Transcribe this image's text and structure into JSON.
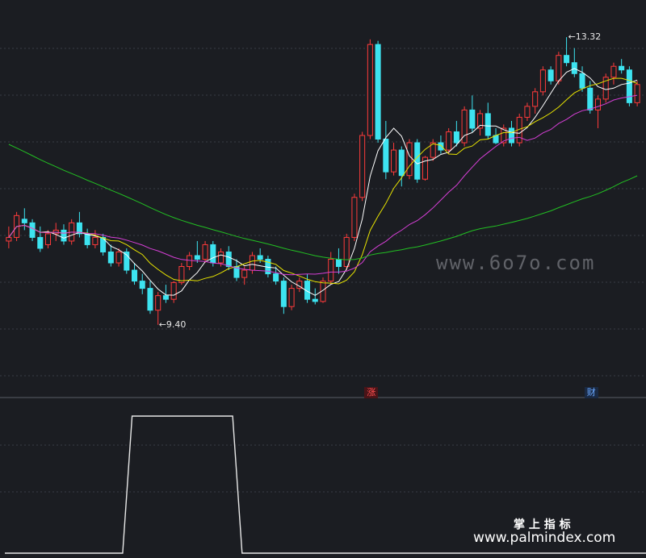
{
  "chart_data": [
    {
      "type": "candlestick",
      "panel": "main",
      "ylim": [
        8.6,
        13.75
      ],
      "candles": [
        [
          10.55,
          10.75,
          10.45,
          10.6
        ],
        [
          10.6,
          10.95,
          10.55,
          10.9
        ],
        [
          10.85,
          11.0,
          10.7,
          10.8
        ],
        [
          10.8,
          10.85,
          10.55,
          10.6
        ],
        [
          10.6,
          10.75,
          10.4,
          10.45
        ],
        [
          10.5,
          10.7,
          10.45,
          10.65
        ],
        [
          10.65,
          10.8,
          10.55,
          10.7
        ],
        [
          10.7,
          10.78,
          10.5,
          10.55
        ],
        [
          10.55,
          10.85,
          10.5,
          10.8
        ],
        [
          10.8,
          10.95,
          10.6,
          10.65
        ],
        [
          10.65,
          10.72,
          10.45,
          10.5
        ],
        [
          10.5,
          10.7,
          10.45,
          10.6
        ],
        [
          10.6,
          10.65,
          10.35,
          10.4
        ],
        [
          10.4,
          10.5,
          10.2,
          10.25
        ],
        [
          10.25,
          10.45,
          10.2,
          10.4
        ],
        [
          10.4,
          10.45,
          10.1,
          10.15
        ],
        [
          10.15,
          10.25,
          9.95,
          10.0
        ],
        [
          10.0,
          10.1,
          9.82,
          9.9
        ],
        [
          9.9,
          10.0,
          9.55,
          9.6
        ],
        [
          9.6,
          9.85,
          9.4,
          9.8
        ],
        [
          9.8,
          9.95,
          9.7,
          9.75
        ],
        [
          9.75,
          10.0,
          9.7,
          9.98
        ],
        [
          9.98,
          10.25,
          9.95,
          10.2
        ],
        [
          10.2,
          10.4,
          10.15,
          10.35
        ],
        [
          10.35,
          10.55,
          10.25,
          10.3
        ],
        [
          10.3,
          10.55,
          10.25,
          10.5
        ],
        [
          10.5,
          10.55,
          10.2,
          10.25
        ],
        [
          10.25,
          10.45,
          10.2,
          10.4
        ],
        [
          10.4,
          10.48,
          10.15,
          10.2
        ],
        [
          10.2,
          10.3,
          10.0,
          10.05
        ],
        [
          10.05,
          10.2,
          9.95,
          10.15
        ],
        [
          10.15,
          10.4,
          10.1,
          10.35
        ],
        [
          10.35,
          10.45,
          10.25,
          10.3
        ],
        [
          10.3,
          10.35,
          10.05,
          10.1
        ],
        [
          10.1,
          10.2,
          9.95,
          10.0
        ],
        [
          10.0,
          10.05,
          9.55,
          9.65
        ],
        [
          9.65,
          9.95,
          9.6,
          9.9
        ],
        [
          9.9,
          10.05,
          9.85,
          10.0
        ],
        [
          10.0,
          10.1,
          9.7,
          9.75
        ],
        [
          9.75,
          9.9,
          9.68,
          9.72
        ],
        [
          9.72,
          10.05,
          9.7,
          10.0
        ],
        [
          10.0,
          10.4,
          9.95,
          10.3
        ],
        [
          10.3,
          10.45,
          10.1,
          10.2
        ],
        [
          10.2,
          10.65,
          10.15,
          10.6
        ],
        [
          10.6,
          11.2,
          10.55,
          11.15
        ],
        [
          11.15,
          12.05,
          11.1,
          12.0
        ],
        [
          12.0,
          13.32,
          11.95,
          13.25
        ],
        [
          13.25,
          13.3,
          11.9,
          11.95
        ],
        [
          11.95,
          12.2,
          11.4,
          11.5
        ],
        [
          11.5,
          11.9,
          11.45,
          11.8
        ],
        [
          11.8,
          11.85,
          11.3,
          11.45
        ],
        [
          11.45,
          11.95,
          11.4,
          11.9
        ],
        [
          11.9,
          11.95,
          11.35,
          11.4
        ],
        [
          11.4,
          11.72,
          11.38,
          11.7
        ],
        [
          11.7,
          11.95,
          11.65,
          11.9
        ],
        [
          11.9,
          12.0,
          11.75,
          11.8
        ],
        [
          11.8,
          12.1,
          11.75,
          12.05
        ],
        [
          12.05,
          12.2,
          11.85,
          11.9
        ],
        [
          11.9,
          12.4,
          11.85,
          12.35
        ],
        [
          12.35,
          12.55,
          12.05,
          12.1
        ],
        [
          12.1,
          12.35,
          12.0,
          12.3
        ],
        [
          12.3,
          12.45,
          11.95,
          12.0
        ],
        [
          12.0,
          12.1,
          11.88,
          11.9
        ],
        [
          11.9,
          12.15,
          11.85,
          12.1
        ],
        [
          12.1,
          12.2,
          11.85,
          11.9
        ],
        [
          11.9,
          12.3,
          11.85,
          12.25
        ],
        [
          12.25,
          12.45,
          12.2,
          12.4
        ],
        [
          12.4,
          12.65,
          12.3,
          12.6
        ],
        [
          12.6,
          12.95,
          12.55,
          12.9
        ],
        [
          12.9,
          12.95,
          12.7,
          12.75
        ],
        [
          12.75,
          13.15,
          12.7,
          13.1
        ],
        [
          13.1,
          13.35,
          12.95,
          13.0
        ],
        [
          13.0,
          13.2,
          12.8,
          12.85
        ],
        [
          12.85,
          12.95,
          12.6,
          12.65
        ],
        [
          12.65,
          12.75,
          12.3,
          12.35
        ],
        [
          12.35,
          12.55,
          12.1,
          12.5
        ],
        [
          12.5,
          12.85,
          12.45,
          12.8
        ],
        [
          12.8,
          13.0,
          12.7,
          12.95
        ],
        [
          12.95,
          13.05,
          12.85,
          12.9
        ],
        [
          12.9,
          12.95,
          12.4,
          12.45
        ],
        [
          12.45,
          12.75,
          12.4,
          12.7
        ]
      ],
      "ma": [
        {
          "color": "#ffffff",
          "period": 5
        },
        {
          "color": "#e8e400",
          "period": 10
        },
        {
          "color": "#d63fd6",
          "period": 20
        },
        {
          "color": "#22c022",
          "period": 60
        }
      ],
      "annotations": [
        {
          "text": "13.32",
          "type": "high"
        },
        {
          "text": "9.40",
          "type": "low"
        }
      ],
      "markers": [
        {
          "text": "涨",
          "color": "#ff5050",
          "bg": "#4a1418"
        },
        {
          "text": "财",
          "color": "#6aa8ff",
          "bg": "#1a2a44"
        }
      ]
    },
    {
      "type": "line",
      "panel": "indicator",
      "ylim": [
        0,
        1
      ],
      "values": [
        0,
        0,
        0,
        0,
        0,
        0,
        0,
        0,
        0,
        0,
        0,
        0,
        0,
        0,
        0,
        0,
        1,
        1,
        1,
        1,
        1,
        1,
        1,
        1,
        1,
        1,
        1,
        1,
        1,
        1,
        0,
        0,
        0,
        0,
        0,
        0,
        0,
        0,
        0,
        0,
        0,
        0,
        0,
        0,
        0,
        0,
        0,
        0,
        0,
        0,
        0,
        0,
        0,
        0,
        0,
        0,
        0,
        0,
        0,
        0,
        0,
        0,
        0,
        0,
        0,
        0,
        0,
        0,
        0,
        0,
        0,
        0,
        0,
        0,
        0,
        0,
        0,
        0,
        0,
        0,
        0
      ]
    }
  ],
  "watermark": "www.6o7o.com",
  "brand": {
    "title": "掌 上 指 标",
    "url": "www.palmindex.com"
  }
}
